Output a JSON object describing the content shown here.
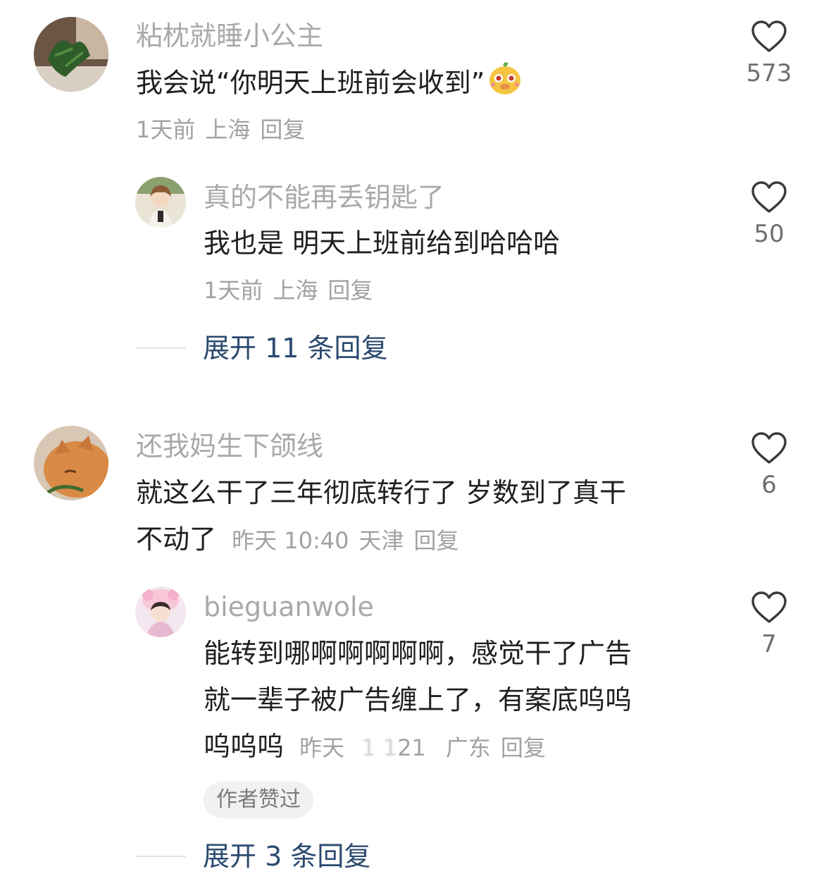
{
  "comments": [
    {
      "username": "粘枕就睡小公主",
      "text": "我会说“你明天上班前会收到”",
      "emoji": "sticker-face-icon",
      "time": "1天前",
      "location": "上海",
      "reply_label": "回复",
      "likes": "573",
      "replies": [
        {
          "username": "真的不能再丢钥匙了",
          "text": "我也是 明天上班前给到哈哈哈",
          "time": "1天前",
          "location": "上海",
          "reply_label": "回复",
          "likes": "50"
        }
      ],
      "expand_label": "展开 11 条回复"
    },
    {
      "username": "还我妈生下颌线",
      "text_line1": "就这么干了三年彻底转行了 岁数到了真干",
      "text_line2": "不动了",
      "time": "昨天 10:40",
      "location": "天津",
      "reply_label": "回复",
      "likes": "6",
      "replies": [
        {
          "username": "bieguanwole",
          "text_line1": "能转到哪啊啊啊啊啊，感觉干了广告",
          "text_line2": "就一辈子被广告缠上了，有案底呜呜",
          "text_line3": "呜呜呜",
          "time_prefix": "昨天",
          "time_obscured": "1 1",
          "time_suffix": "21",
          "location": "广东",
          "reply_label": "回复",
          "likes": "7",
          "author_badge": "作者赞过"
        }
      ],
      "expand_label": "展开 3 条回复"
    }
  ],
  "colors": {
    "username": "#a9a9a9",
    "content": "#1f1f1f",
    "meta": "#a2a2a2",
    "expand_link": "#2b4a6f",
    "badge_bg": "#f1f1f1"
  },
  "icons": {
    "like": "heart-outline-icon"
  }
}
